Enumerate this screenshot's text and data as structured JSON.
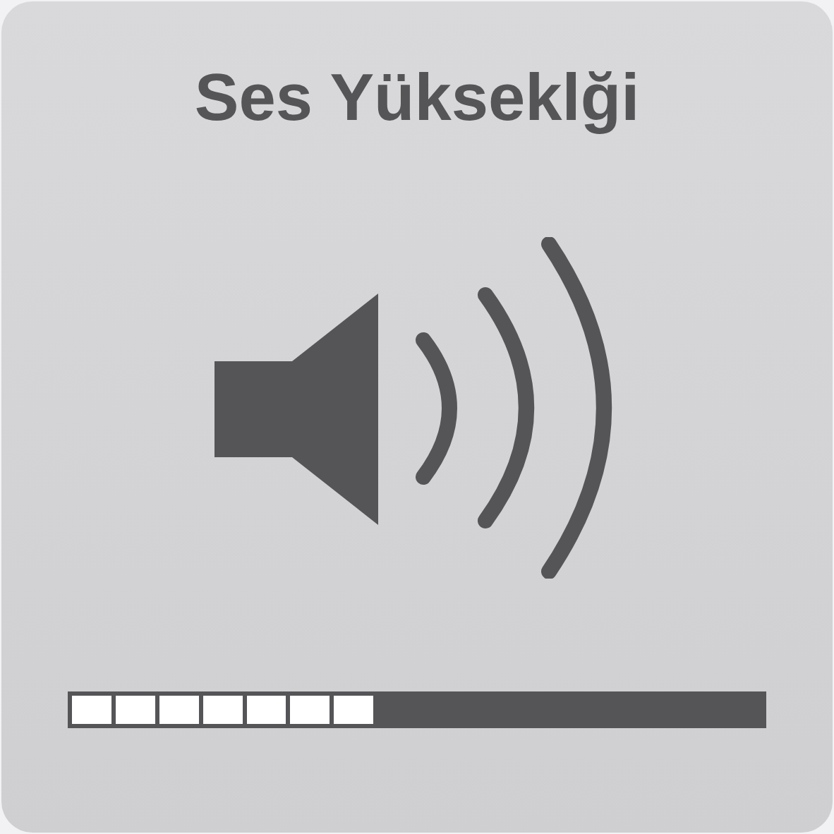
{
  "hud": {
    "title": "Ses Yükseklği",
    "volume": {
      "level": 0.4375
    }
  }
}
